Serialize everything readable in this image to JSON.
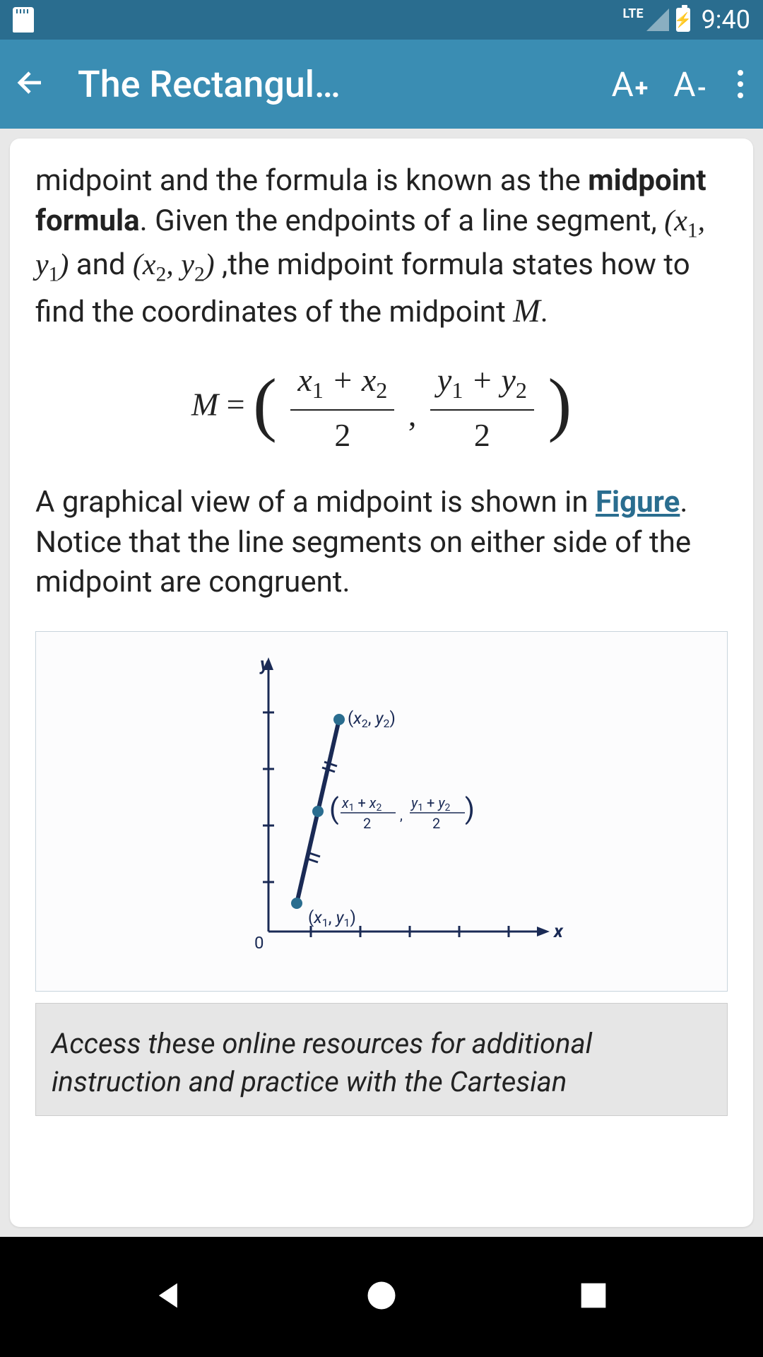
{
  "status": {
    "network": "LTE",
    "time": "9:40",
    "battery_icon": "⚡"
  },
  "appbar": {
    "title": "The Rectangul…",
    "font_up_label": "A",
    "font_up_sup": "+",
    "font_down_label": "A",
    "font_down_sup": "-"
  },
  "content": {
    "para1_a": "midpoint and the formula is known as the ",
    "para1_bold": "midpoint formula",
    "para1_b": ". Given the endpoints of a line segment, ",
    "endpoint1": "(x₁, y₁)",
    "para1_c": " and ",
    "endpoint2": "(x₂, y₂)",
    "para1_d": " ,the midpoint formula states how to find the coordinates of the midpoint ",
    "var_M": "M",
    "para1_e": ".",
    "formula_lhs": "M =",
    "formula_num1": "x₁ + x₂",
    "formula_den": "2",
    "formula_num2": "y₁ + y₂",
    "para2_a": "A graphical view of a midpoint is shown in ",
    "figure_link": "Figure",
    "para2_b": ". Notice that the line segments on either side of the midpoint are congruent.",
    "graph": {
      "y_label": "y",
      "x_label": "x",
      "origin": "0",
      "pt1_label": "(x₁, y₁)",
      "pt2_label": "(x₂, y₂)",
      "mid_num1": "x₁ + x₂",
      "mid_num2": "y₁ + y₂",
      "mid_den": "2"
    },
    "resources": "Access these online resources for additional instruction and practice with the Cartesian"
  }
}
